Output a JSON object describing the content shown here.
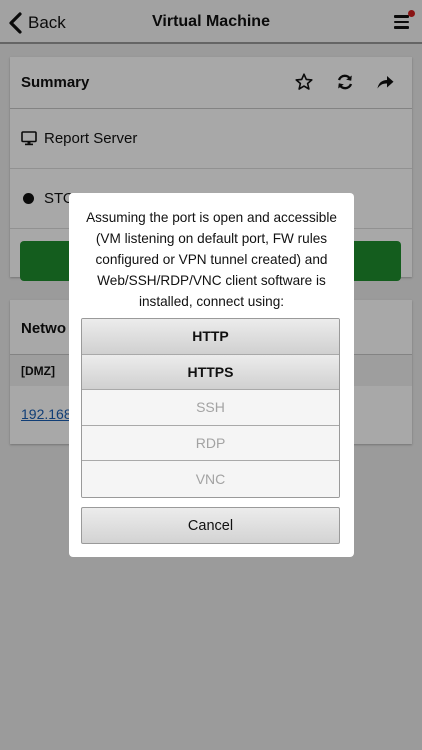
{
  "nav": {
    "back_label": "Back",
    "title": "Virtual Machine",
    "back_icon": "chevron-left-icon",
    "menu_icon": "hamburger-menu-icon",
    "notification_color": "#d21f1f"
  },
  "summary": {
    "title": "Summary",
    "actions": [
      "star-icon",
      "refresh-icon",
      "share-icon"
    ],
    "server_name": "Report Server",
    "status_text": "STO",
    "action_button_color": "#1f8e2e"
  },
  "network": {
    "title": "Netwo",
    "zone": "[DMZ]",
    "ip": "192.168"
  },
  "dialog": {
    "message": "Assuming the port is open and accessible (VM listening on default port, FW rules configured or VPN tunnel created) and Web/SSH/RDP/VNC client software is installed, connect using:",
    "options": [
      {
        "label": "HTTP",
        "state": "enabled"
      },
      {
        "label": "HTTPS",
        "state": "enabled"
      },
      {
        "label": "SSH",
        "state": "disabled"
      },
      {
        "label": "RDP",
        "state": "disabled"
      },
      {
        "label": "VNC",
        "state": "disabled"
      }
    ],
    "cancel_label": "Cancel"
  }
}
